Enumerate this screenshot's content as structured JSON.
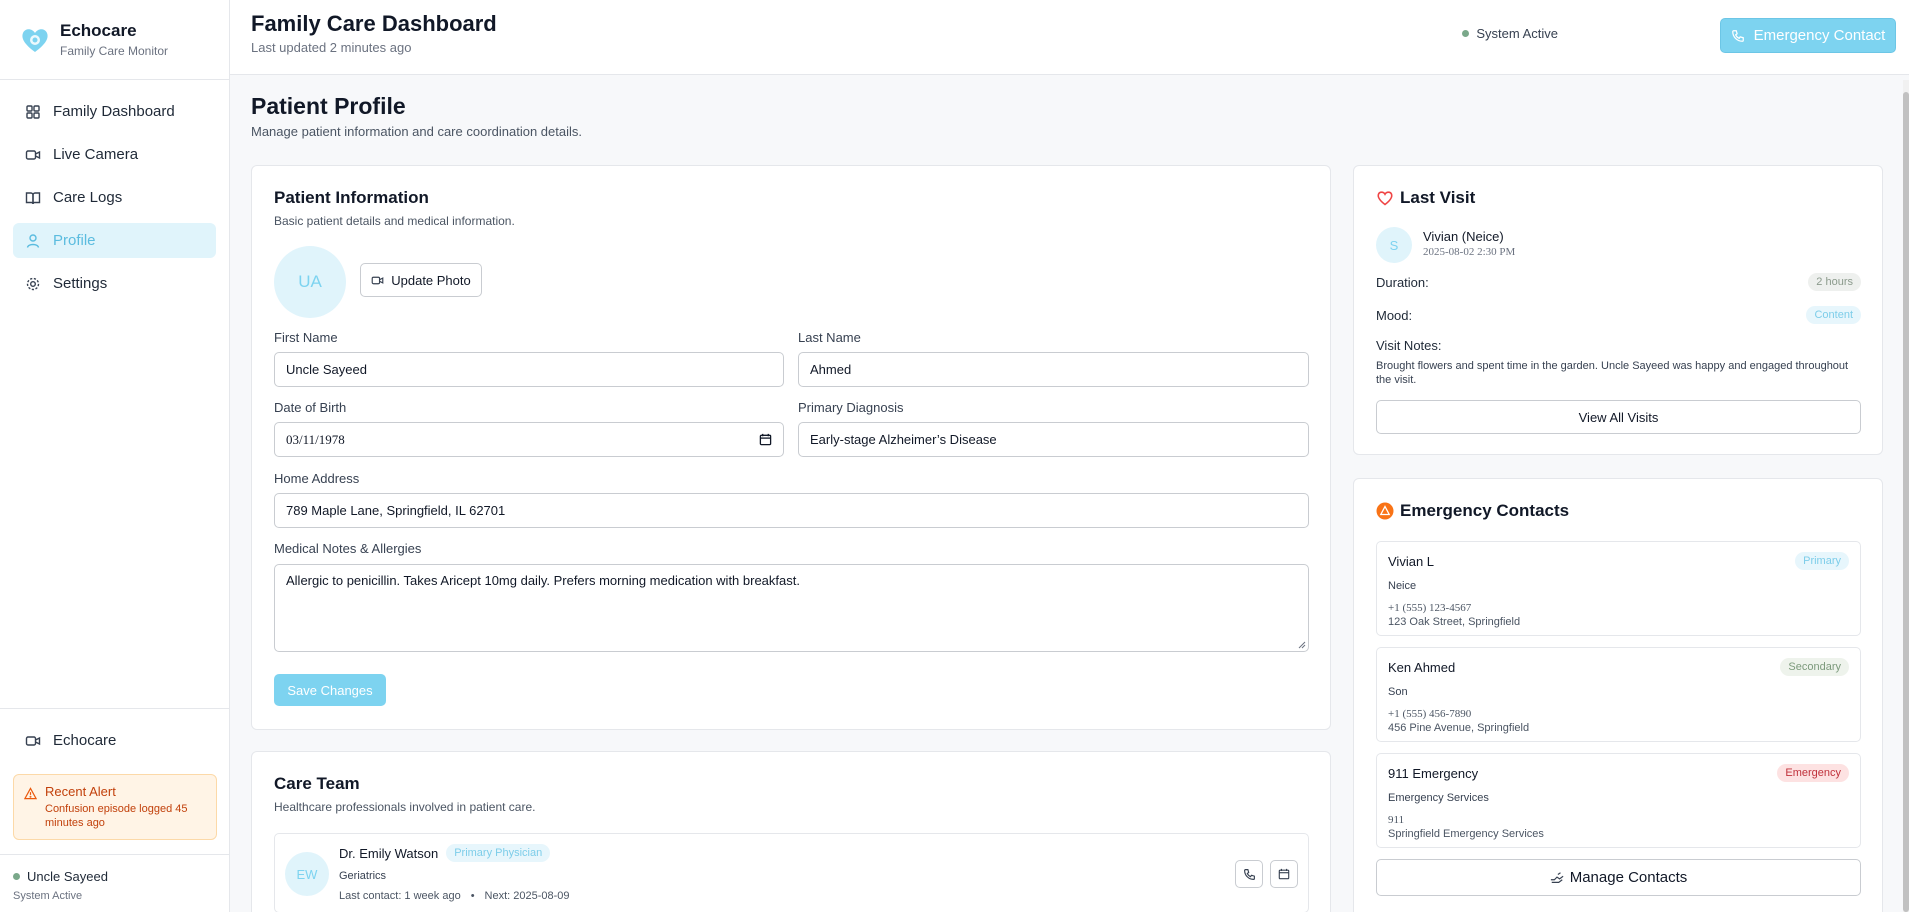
{
  "brand": {
    "name": "Echocare",
    "subtitle": "Family Care Monitor"
  },
  "nav": [
    {
      "label": "Family Dashboard",
      "icon": "grid-icon",
      "active": false
    },
    {
      "label": "Live Camera",
      "icon": "video-icon",
      "active": false
    },
    {
      "label": "Care Logs",
      "icon": "book-icon",
      "active": false
    },
    {
      "label": "Profile",
      "icon": "user-icon",
      "active": true
    },
    {
      "label": "Settings",
      "icon": "gear-icon",
      "active": false
    }
  ],
  "sidebar_bottom": {
    "echocare_label": "Echocare",
    "alert_title": "Recent Alert",
    "alert_text": "Confusion episode logged 45 minutes ago",
    "user_name": "Uncle Sayeed",
    "user_status": "System Active"
  },
  "header": {
    "title": "Family Care Dashboard",
    "updated": "Last updated 2 minutes ago",
    "system_status": "System Active",
    "emergency_button": "Emergency Contact"
  },
  "main": {
    "title": "Patient Profile",
    "subtitle": "Manage patient information and care coordination details."
  },
  "patient_info": {
    "title": "Patient Information",
    "subtitle": "Basic patient details and medical information.",
    "avatar_initials": "UA",
    "update_photo": "Update Photo",
    "first_name_label": "First Name",
    "first_name": "Uncle Sayeed",
    "last_name_label": "Last Name",
    "last_name": "Ahmed",
    "dob_label": "Date of Birth",
    "dob": "03/11/1978",
    "diagnosis_label": "Primary Diagnosis",
    "diagnosis": "Early-stage Alzheimer’s Disease",
    "address_label": "Home Address",
    "address": "789 Maple Lane, Springfield, IL 62701",
    "notes_label": "Medical Notes & Allergies",
    "notes": "Allergic to penicillin. Takes Aricept 10mg daily. Prefers morning medication with breakfast.",
    "save_button": "Save Changes"
  },
  "care_team": {
    "title": "Care Team",
    "subtitle": "Healthcare professionals involved in patient care.",
    "members": [
      {
        "initials": "EW",
        "name": "Dr. Emily Watson",
        "badge": "Primary Physician",
        "specialty": "Geriatrics",
        "last_contact": "Last contact: 1 week ago",
        "separator": "•",
        "next": "Next: 2025-08-09"
      }
    ]
  },
  "last_visit": {
    "title": "Last Visit",
    "visitor_initial": "S",
    "visitor_name": "Vivian (Neice)",
    "visit_time": "2025-08-02 2:30 PM",
    "duration_label": "Duration:",
    "duration": "2 hours",
    "mood_label": "Mood:",
    "mood": "Content",
    "notes_label": "Visit Notes:",
    "notes": "Brought flowers and spent time in the garden. Uncle Sayeed was happy and engaged throughout the visit.",
    "view_all": "View All Visits"
  },
  "emergency_contacts": {
    "title": "Emergency Contacts",
    "contacts": [
      {
        "name": "Vivian L",
        "badge": "Primary",
        "relation": "Neice",
        "phone": "+1 (555) 123-4567",
        "address": "123 Oak Street, Springfield"
      },
      {
        "name": "Ken Ahmed",
        "badge": "Secondary",
        "relation": "Son",
        "phone": "+1 (555) 456-7890",
        "address": "456 Pine Avenue, Springfield"
      },
      {
        "name": "911 Emergency",
        "badge": "Emergency",
        "relation": "Emergency Services",
        "phone": "911",
        "address": "Springfield Emergency Services"
      }
    ],
    "manage_button": "Manage Contacts"
  },
  "colors": {
    "accent": "#7dd3f0",
    "alert": "#c2410c",
    "heart": "#ef4444",
    "warning": "#f97316"
  }
}
